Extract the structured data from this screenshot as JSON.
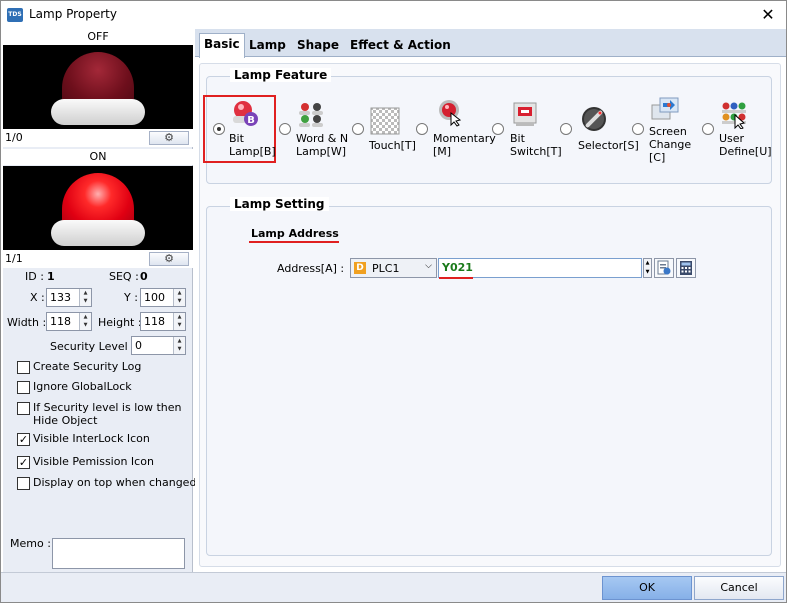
{
  "window": {
    "title": "Lamp Property",
    "app_icon": "TDS",
    "close_glyph": "✕"
  },
  "left": {
    "off_label": "OFF",
    "off_index": "1/0",
    "on_label": "ON",
    "on_index": "1/1",
    "gear_glyph": "⚙",
    "id_label": "ID :",
    "id_value": "1",
    "seq_label": "SEQ :",
    "seq_value": "0",
    "x_label": "X :",
    "x_value": "133",
    "y_label": "Y :",
    "y_value": "100",
    "width_label": "Width :",
    "width_value": "118",
    "height_label": "Height :",
    "height_value": "118",
    "security_label": "Security Level :",
    "security_value": "0",
    "checkboxes": [
      {
        "label": "Create Security Log",
        "checked": false
      },
      {
        "label": "Ignore GlobalLock",
        "checked": false
      },
      {
        "label": "If Security level is low then",
        "label2": "Hide Object",
        "checked": false
      },
      {
        "label": "Visible InterLock Icon",
        "checked": true
      },
      {
        "label": "Visible Pemission Icon",
        "checked": true
      },
      {
        "label": "Display on top when changed",
        "checked": false
      }
    ],
    "memo_label": "Memo :"
  },
  "tabs": [
    "Basic",
    "Lamp",
    "Shape",
    "Effect & Action"
  ],
  "lamp_feature": {
    "title": "Lamp Feature",
    "options": [
      {
        "line1": "Bit",
        "line2": "Lamp[B]",
        "icon": "bit-lamp-icon",
        "selected": true
      },
      {
        "line1": "Word & N",
        "line2": "Lamp[W]",
        "icon": "word-lamp-icon",
        "selected": false
      },
      {
        "line1": "Touch[T]",
        "line2": "",
        "icon": "touch-icon",
        "selected": false
      },
      {
        "line1": "Momentary",
        "line2": "[M]",
        "icon": "momentary-icon",
        "selected": false
      },
      {
        "line1": "Bit",
        "line2": "Switch[T]",
        "icon": "bit-switch-icon",
        "selected": false
      },
      {
        "line1": "Selector[S]",
        "line2": "",
        "icon": "selector-icon",
        "selected": false
      },
      {
        "line1": "Screen",
        "line2": "Change",
        "line3": "[C]",
        "icon": "screen-change-icon",
        "selected": false
      },
      {
        "line1": "User",
        "line2": "Define[U]",
        "icon": "user-define-icon",
        "selected": false
      }
    ]
  },
  "lamp_setting": {
    "title": "Lamp Setting",
    "address_title": "Lamp Address",
    "address_label": "Address[A] :",
    "device_badge": "D",
    "device_value": "PLC1",
    "address_value": "Y021"
  },
  "buttons": {
    "ok": "OK",
    "cancel": "Cancel"
  },
  "colors": {
    "highlight_red": "#e02020",
    "address_text": "#1a7a1a",
    "ok_blue": "#94bbee"
  }
}
